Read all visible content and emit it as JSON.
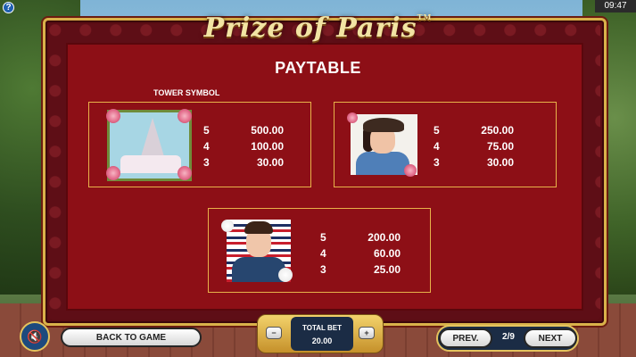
{
  "game": {
    "title": "Prize of Paris",
    "trademark": "TM"
  },
  "system": {
    "clock": "09:47",
    "help_icon": "?"
  },
  "paytable": {
    "title": "PAYTABLE",
    "symbol_caption": "TOWER SYMBOL",
    "entries": [
      {
        "symbol": "eiffel-tower",
        "rows": [
          {
            "count": "5",
            "amount": "500.00"
          },
          {
            "count": "4",
            "amount": "100.00"
          },
          {
            "count": "3",
            "amount": "30.00"
          }
        ]
      },
      {
        "symbol": "parisian-woman",
        "rows": [
          {
            "count": "5",
            "amount": "250.00"
          },
          {
            "count": "4",
            "amount": "75.00"
          },
          {
            "count": "3",
            "amount": "30.00"
          }
        ]
      },
      {
        "symbol": "parisian-man",
        "rows": [
          {
            "count": "5",
            "amount": "200.00"
          },
          {
            "count": "4",
            "amount": "60.00"
          },
          {
            "count": "3",
            "amount": "25.00"
          }
        ]
      }
    ]
  },
  "controls": {
    "back_label": "BACK TO GAME",
    "prev_label": "PREV.",
    "next_label": "NEXT",
    "page_indicator": "2/9",
    "total_bet_label": "TOTAL BET",
    "total_bet_value": "20.00",
    "minus": "−",
    "plus": "+",
    "sound_icon": "🔇"
  }
}
